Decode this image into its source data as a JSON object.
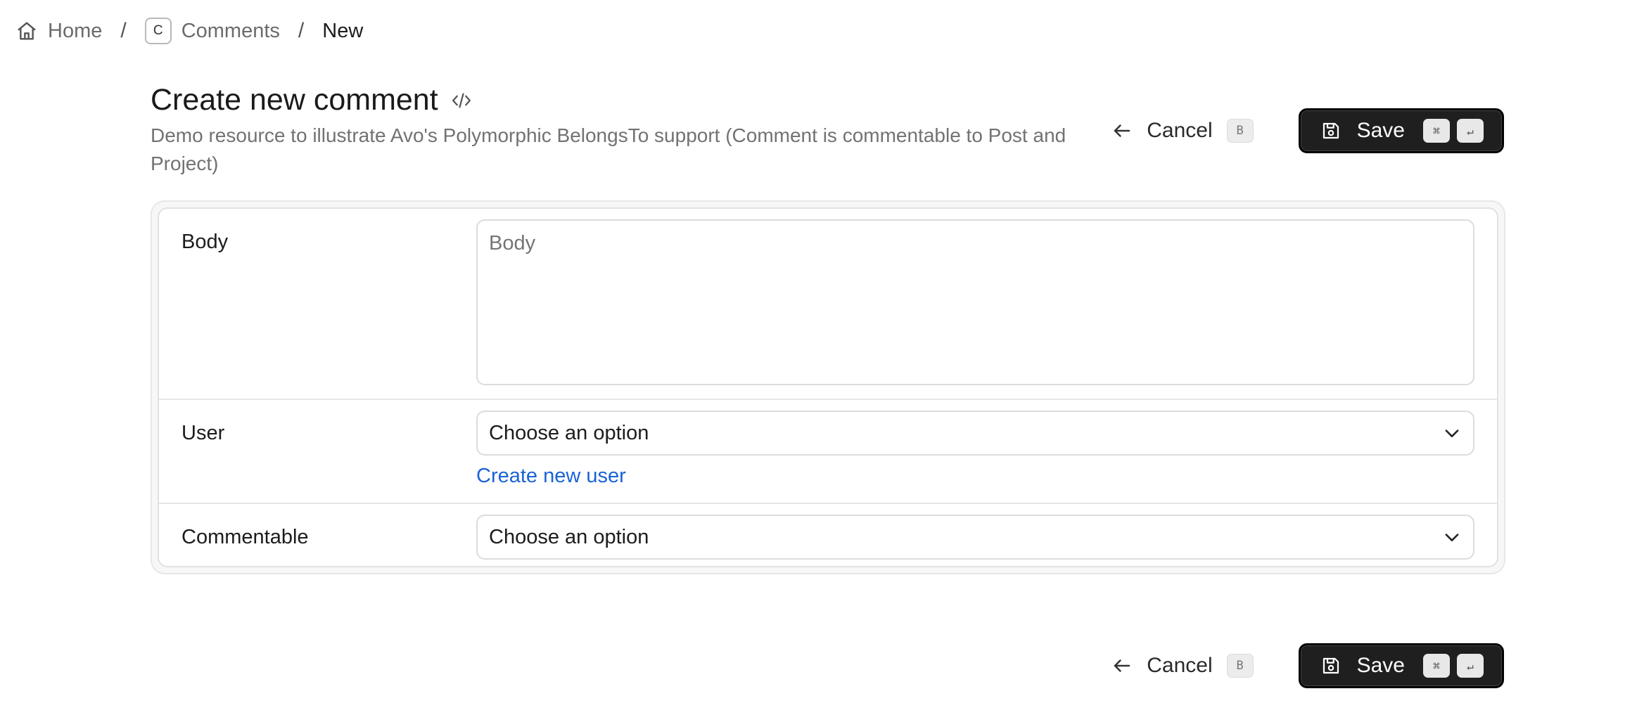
{
  "breadcrumb": {
    "home": "Home",
    "separator": "/",
    "resource_badge": "C",
    "resource": "Comments",
    "current": "New"
  },
  "header": {
    "title": "Create new comment",
    "description": "Demo resource to illustrate Avo's Polymorphic BelongsTo support (Comment is commentable to Post and Project)"
  },
  "actions": {
    "cancel_label": "Cancel",
    "cancel_shortcut": "B",
    "save_label": "Save",
    "save_shortcut_mod": "⌘",
    "save_shortcut_key": "↵"
  },
  "form": {
    "body": {
      "label": "Body",
      "placeholder": "Body",
      "value": ""
    },
    "user": {
      "label": "User",
      "selected": "Choose an option",
      "create_link": "Create new user"
    },
    "commentable": {
      "label": "Commentable",
      "selected": "Choose an option"
    }
  },
  "icons": {
    "home": "home-icon",
    "code": "code-icon",
    "cancel": "arrow-left-icon",
    "save": "floppy-disk-icon",
    "select": "chevron-down-icon"
  },
  "colors": {
    "link": "#1a63d6",
    "save_button_bg": "#1f1f1f"
  }
}
